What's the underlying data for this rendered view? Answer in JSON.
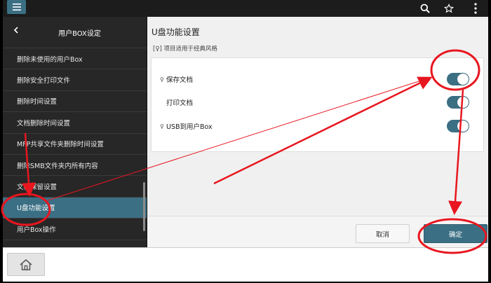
{
  "sidebar": {
    "title": "用户BOX设定",
    "items": [
      {
        "label": "删除未使用的用户Box"
      },
      {
        "label": "删除安全打印文件"
      },
      {
        "label": "删除时间设置"
      },
      {
        "label": "文档删除时间设置"
      },
      {
        "label": "MFP共享文件夹删除时间设置"
      },
      {
        "label": "删除SMB文件夹内所有内容"
      },
      {
        "label": "文档保留设置"
      },
      {
        "label": "U盘功能设置"
      },
      {
        "label": "用户Box操作"
      }
    ],
    "active_index": 7
  },
  "main": {
    "title": "U盘功能设置",
    "note": "[♀] 项目适用于经典风格",
    "settings": [
      {
        "label": "保存文档",
        "pinned": true,
        "on": true
      },
      {
        "label": "打印文档",
        "pinned": false,
        "on": true
      },
      {
        "label": "USB到用户Box",
        "pinned": true,
        "on": true
      }
    ]
  },
  "buttons": {
    "cancel": "取消",
    "ok": "确定"
  },
  "colors": {
    "accent": "#3b6f84",
    "annotation": "#e8161f"
  },
  "icons": {
    "menu": "menu-icon",
    "search": "search-icon",
    "star": "star-icon",
    "more": "more-vertical-icon",
    "back": "chevron-left-icon",
    "home": "home-icon",
    "pin": "pin-icon"
  }
}
